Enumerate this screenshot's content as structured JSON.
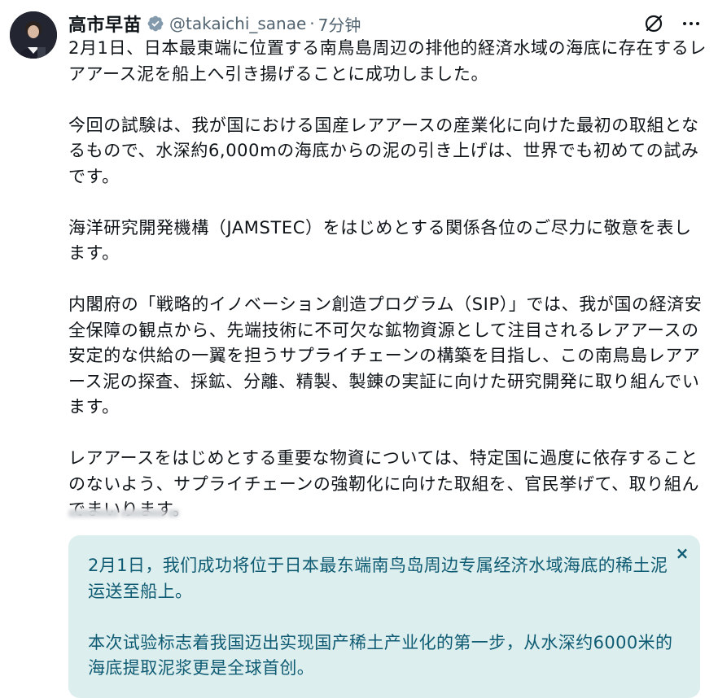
{
  "author": {
    "name": "高市早苗",
    "handle": "@takaichi_sanae",
    "separator": "·",
    "time": "7分钟"
  },
  "tweet": {
    "paragraphs": [
      "2月1日、日本最東端に位置する南鳥島周辺の排他的経済水域の海底に存在するレアアース泥を船上へ引き揚げることに成功しました。",
      "今回の試験は、我が国における国産レアアースの産業化に向けた最初の取組となるもので、水深約6,000mの海底からの泥の引き上げは、世界でも初めての試みです。",
      "海洋研究開発機構（JAMSTEC）をはじめとする関係各位のご尽力に敬意を表します。",
      "内閣府の「戦略的イノベーション創造プログラム（SIP）」では、我が国の経済安全保障の観点から、先端技術に不可欠な鉱物資源として注目されるレアアースの安定的な供給の一翼を担うサプライチェーンの構築を目指し、この南鳥島レアアース泥の探査、採鉱、分離、精製、製錬の実証に向けた研究開発に取り組んでいます。",
      "レアアースをはじめとする重要な物資については、特定国に過度に依存することのないよう、サプライチェーンの強靭化に向けた取組を、官民挙げて、取り組んでまいります。"
    ]
  },
  "translation": {
    "paragraphs": [
      "2月1日，我们成功将位于日本最东端南鸟岛周边专属经济水域海底的稀土泥运送至船上。",
      "本次试验标志着我国迈出实现国产稀土产业化的第一步，从水深约6000米的海底提取泥浆更是全球首创。"
    ],
    "close_label": "×"
  },
  "colors": {
    "text": "#0f1419",
    "muted": "#536471",
    "translation_bg": "#dceeed",
    "translation_text": "#0e5b73",
    "verified": "#829aab"
  },
  "icons": {
    "verified": "verified-badge-icon",
    "grok": "grok-icon",
    "more": "more-icon",
    "close": "close-icon"
  }
}
